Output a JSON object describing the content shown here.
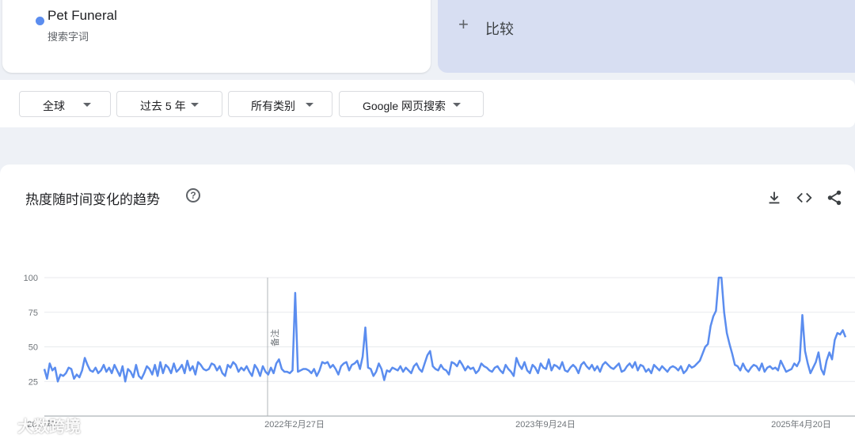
{
  "search_term": {
    "name": "Pet Funeral",
    "sub": "搜索字词",
    "color": "#5b8def"
  },
  "compare": {
    "label": "比较"
  },
  "filters": [
    {
      "label": "全球"
    },
    {
      "label": "过去 5 年"
    },
    {
      "label": "所有类别"
    },
    {
      "label": "Google 网页搜索"
    }
  ],
  "chart_card": {
    "title": "热度随时间变化的趋势",
    "annotation": "备注",
    "icons": [
      "download-icon",
      "embed-code-icon",
      "share-icon"
    ]
  },
  "watermark": "大数跨境",
  "chart_data": {
    "type": "line",
    "title": "",
    "xlabel": "",
    "ylabel": "",
    "ylim": [
      0,
      100
    ],
    "yticks": [
      25,
      50,
      75,
      100
    ],
    "x_tick_labels": [
      "2020年6",
      "2022年2月27日",
      "2023年9月24日",
      "2025年4月20日"
    ],
    "series": [
      {
        "name": "Pet Funeral",
        "color": "#5b8def",
        "values": [
          34,
          27,
          38,
          33,
          35,
          25,
          30,
          29,
          31,
          35,
          34,
          27,
          30,
          28,
          33,
          42,
          37,
          33,
          32,
          35,
          31,
          33,
          37,
          32,
          35,
          31,
          37,
          33,
          29,
          36,
          25,
          34,
          32,
          28,
          37,
          29,
          27,
          31,
          36,
          34,
          30,
          37,
          29,
          39,
          31,
          37,
          35,
          31,
          38,
          32,
          34,
          37,
          31,
          40,
          33,
          36,
          30,
          39,
          37,
          34,
          33,
          34,
          38,
          37,
          33,
          36,
          31,
          29,
          37,
          35,
          39,
          37,
          32,
          35,
          33,
          36,
          32,
          29,
          37,
          34,
          29,
          36,
          32,
          30,
          35,
          31,
          38,
          41,
          34,
          32,
          32,
          31,
          33,
          89,
          32,
          33,
          34,
          34,
          33,
          31,
          34,
          29,
          33,
          39,
          38,
          39,
          35,
          37,
          34,
          30,
          36,
          38,
          39,
          33,
          37,
          38,
          40,
          34,
          43,
          64,
          35,
          34,
          29,
          32,
          38,
          34,
          26,
          33,
          32,
          35,
          34,
          33,
          36,
          32,
          35,
          33,
          31,
          36,
          38,
          34,
          32,
          38,
          44,
          47,
          36,
          34,
          33,
          37,
          34,
          33,
          30,
          39,
          38,
          36,
          40,
          37,
          33,
          36,
          34,
          35,
          31,
          33,
          38,
          36,
          35,
          33,
          32,
          35,
          36,
          33,
          31,
          37,
          34,
          32,
          29,
          42,
          37,
          34,
          39,
          33,
          31,
          37,
          35,
          31,
          38,
          35,
          34,
          41,
          33,
          37,
          36,
          34,
          39,
          33,
          32,
          35,
          37,
          35,
          31,
          37,
          39,
          36,
          34,
          37,
          33,
          36,
          32,
          37,
          39,
          37,
          35,
          34,
          36,
          38,
          32,
          33,
          36,
          38,
          35,
          39,
          33,
          37,
          36,
          32,
          34,
          31,
          37,
          35,
          33,
          36,
          34,
          32,
          35,
          36,
          35,
          33,
          36,
          31,
          33,
          37,
          35,
          36,
          38,
          40,
          45,
          50,
          52,
          65,
          72,
          76,
          100,
          100,
          75,
          60,
          52,
          45,
          37,
          36,
          33,
          38,
          34,
          32,
          35,
          37,
          36,
          33,
          38,
          32,
          35,
          36,
          34,
          35,
          33,
          40,
          36,
          32,
          33,
          34,
          38,
          36,
          40,
          73,
          47,
          38,
          31,
          35,
          39,
          46,
          34,
          30,
          40,
          46,
          41,
          55,
          60,
          59,
          62,
          57
        ]
      }
    ]
  }
}
